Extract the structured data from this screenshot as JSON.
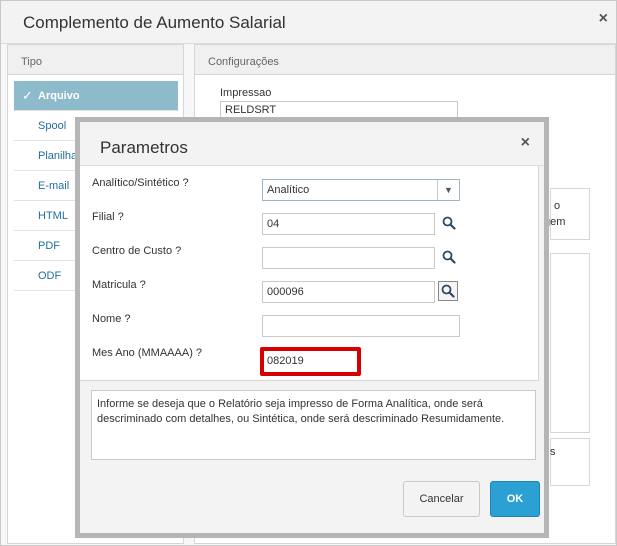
{
  "window": {
    "title": "Complemento de Aumento Salarial",
    "close_glyph": "×"
  },
  "left_panel": {
    "header": "Tipo",
    "items": [
      {
        "label": "Arquivo",
        "active": true
      },
      {
        "label": "Spool"
      },
      {
        "label": "Planilha"
      },
      {
        "label": "E-mail"
      },
      {
        "label": "HTML"
      },
      {
        "label": "PDF"
      },
      {
        "label": "ODF"
      }
    ],
    "check_glyph": "✓"
  },
  "right_panel": {
    "header": "Configurações",
    "impressao_label": "Impressao",
    "impressao_value": "RELDSRT",
    "fragment_1": "o",
    "fragment_2": "gem",
    "fragment_3": "s"
  },
  "modal": {
    "title": "Parametros",
    "close_glyph": "×",
    "fields": {
      "analitico": {
        "label": "Analítico/Sintético ?",
        "value": "Analítico"
      },
      "filial": {
        "label": "Filial ?",
        "value": "04"
      },
      "centro_custo": {
        "label": "Centro de Custo ?",
        "value": ""
      },
      "matricula": {
        "label": "Matricula ?",
        "value": "000096"
      },
      "nome": {
        "label": "Nome ?",
        "value": ""
      },
      "mes_ano": {
        "label": "Mes Ano (MMAAAA) ?",
        "value": "082019"
      }
    },
    "info_text": "Informe se deseja que o Relatório seja impresso de Forma Analítica, onde será descriminado com detalhes, ou Sintética, onde será descriminado Resumidamente.",
    "cancel_label": "Cancelar",
    "ok_label": "OK"
  },
  "colors": {
    "accent": "#2aa1d2",
    "active_item": "#8ebbcb",
    "highlight": "#d60000",
    "link": "#1f6f9c"
  },
  "icons": {
    "search": "search-icon",
    "close": "close-icon",
    "check": "check-icon",
    "dropdown": "caret-down-icon"
  }
}
